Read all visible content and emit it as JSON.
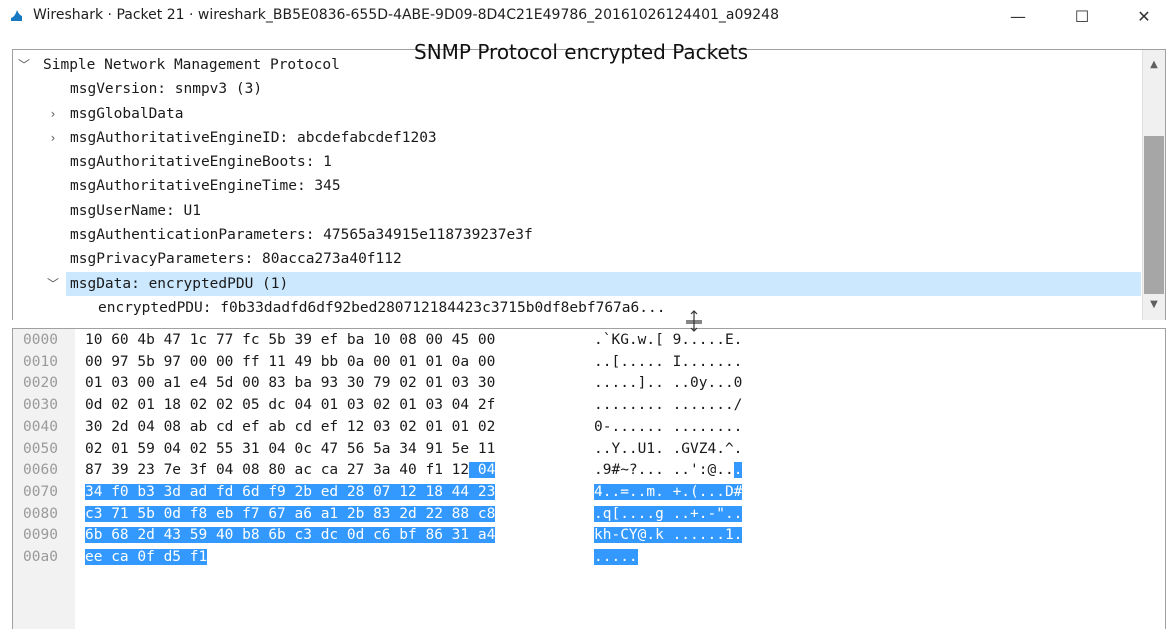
{
  "window": {
    "title": "Wireshark · Packet 21 · wireshark_BB5E0836-655D-4ABE-9D09-8D4C21E49786_20161026124401_a09248",
    "minimize_glyph": "—",
    "maximize_glyph": "☐",
    "close_glyph": "✕",
    "icon": "wireshark-fin-icon"
  },
  "caption": "SNMP Protocol encrypted Packets",
  "details": {
    "rows": [
      {
        "label": "Simple Network Management Protocol",
        "arrow": "﹀",
        "indent": 0
      },
      {
        "label": "msgVersion: snmpv3 (3)",
        "arrow": "",
        "indent": 1
      },
      {
        "label": "msgGlobalData",
        "arrow": "›",
        "indent": 1
      },
      {
        "label": "msgAuthoritativeEngineID: abcdefabcdef1203",
        "arrow": "›",
        "indent": 1
      },
      {
        "label": "msgAuthoritativeEngineBoots: 1",
        "arrow": "",
        "indent": 1
      },
      {
        "label": "msgAuthoritativeEngineTime: 345",
        "arrow": "",
        "indent": 1
      },
      {
        "label": "msgUserName: U1",
        "arrow": "",
        "indent": 1
      },
      {
        "label": "msgAuthenticationParameters: 47565a34915e118739237e3f",
        "arrow": "",
        "indent": 1
      },
      {
        "label": "msgPrivacyParameters: 80acca273a40f112",
        "arrow": "",
        "indent": 1
      },
      {
        "label": "msgData: encryptedPDU (1)",
        "arrow": "﹀",
        "indent": 1
      },
      {
        "label": "encryptedPDU: f0b33dadfd6df92bed280712184423c3715b0df8ebf767a6...",
        "arrow": "",
        "indent": 2
      }
    ],
    "selected_row": 9,
    "scroll_up": "▲",
    "scroll_down": "▼"
  },
  "bytes": {
    "rows": [
      {
        "offset": "0000",
        "hex": "10 60 4b 47 1c 77 fc 5b  39 ef ba 10 08 00 45 00",
        "ascii": ".`KG.w.[ 9.....E.",
        "hl_hex_from": -1,
        "hl_ascii_from": -1
      },
      {
        "offset": "0010",
        "hex": "00 97 5b 97 00 00 ff 11  49 bb 0a 00 01 01 0a 00",
        "ascii": "..[..... I.......",
        "hl_hex_from": -1,
        "hl_ascii_from": -1
      },
      {
        "offset": "0020",
        "hex": "01 03 00 a1 e4 5d 00 83  ba 93 30 79 02 01 03 30",
        "ascii": ".....].. ..0y...0",
        "hl_hex_from": -1,
        "hl_ascii_from": -1
      },
      {
        "offset": "0030",
        "hex": "0d 02 01 18 02 02 05 dc  04 01 03 02 01 03 04 2f",
        "ascii": "........ ......./",
        "hl_hex_from": -1,
        "hl_ascii_from": -1
      },
      {
        "offset": "0040",
        "hex": "30 2d 04 08 ab cd ef ab  cd ef 12 03 02 01 01 02",
        "ascii": "0-...... ........",
        "hl_hex_from": -1,
        "hl_ascii_from": -1
      },
      {
        "offset": "0050",
        "hex": "02 01 59 04 02 55 31 04  0c 47 56 5a 34 91 5e 11",
        "ascii": "..Y..U1. .GVZ4.^.",
        "hl_hex_from": -1,
        "hl_ascii_from": -1
      },
      {
        "offset": "0060",
        "hex": "87 39 23 7e 3f 04 08 80  ac ca 27 3a 40 f1 12 04",
        "ascii": ".9#~?... ..':@...",
        "hl_hex_from": 45,
        "hl_ascii_from": 16
      },
      {
        "offset": "0070",
        "hex": "34 f0 b3 3d ad fd 6d f9  2b ed 28 07 12 18 44 23",
        "ascii": "4..=..m. +.(...D#",
        "hl_hex_from": 0,
        "hl_ascii_from": 0
      },
      {
        "offset": "0080",
        "hex": "c3 71 5b 0d f8 eb f7 67  a6 a1 2b 83 2d 22 88 c8",
        "ascii": ".q[....g ..+.-\"..",
        "hl_hex_from": 0,
        "hl_ascii_from": 0
      },
      {
        "offset": "0090",
        "hex": "6b 68 2d 43 59 40 b8 6b  c3 dc 0d c6 bf 86 31 a4",
        "ascii": "kh-CY@.k ......1.",
        "hl_hex_from": 0,
        "hl_ascii_from": 0
      },
      {
        "offset": "00a0",
        "hex": "ee ca 0f d5 f1",
        "ascii": ".....",
        "hl_hex_from": 0,
        "hl_ascii_from": 0
      }
    ]
  },
  "colors": {
    "selection": "#cce8ff",
    "byte_highlight": "#3399ff"
  }
}
